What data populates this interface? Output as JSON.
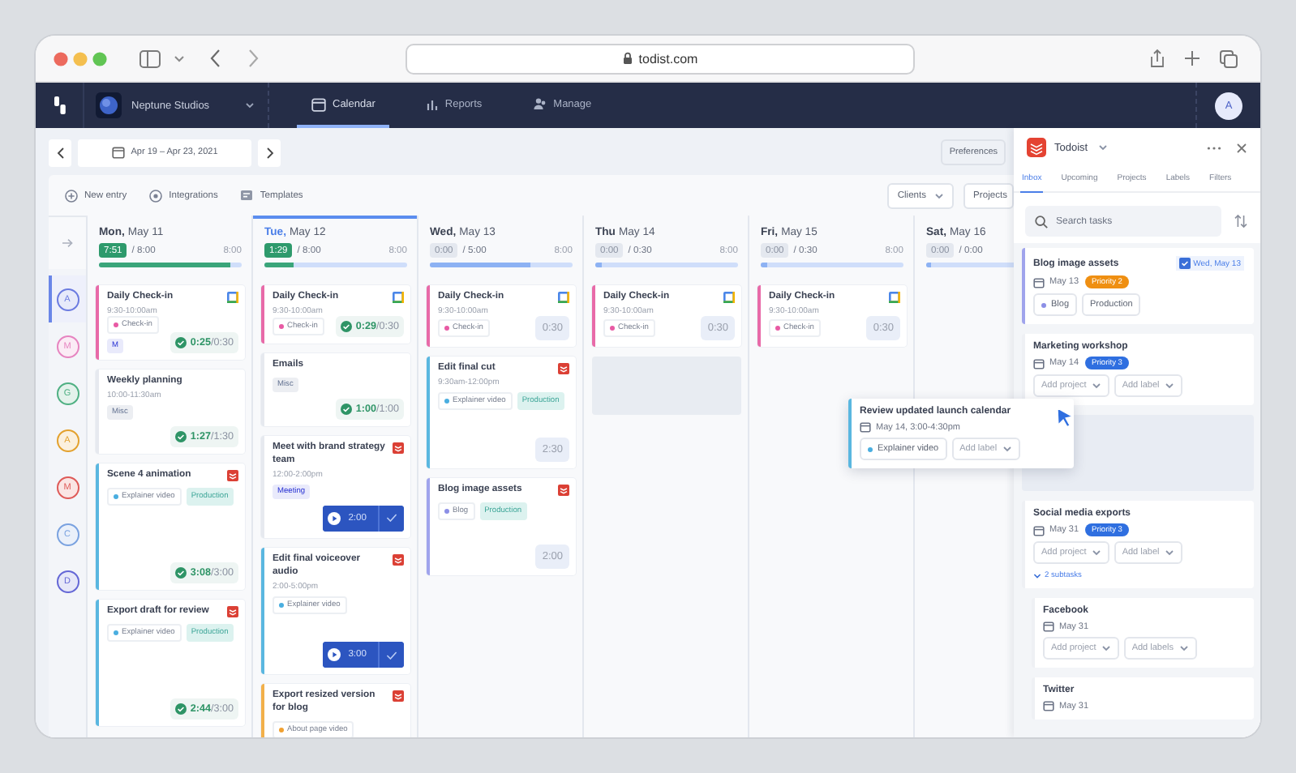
{
  "browser": {
    "address": "todist.com"
  },
  "nav": {
    "workspace": "Neptune Studios",
    "avatar": "A",
    "tabs": [
      {
        "label": "Calendar",
        "selected": true
      },
      {
        "label": "Reports",
        "selected": false
      },
      {
        "label": "Manage",
        "selected": false
      }
    ]
  },
  "date_range": "Apr 19 – Apr 23, 2021",
  "preferences": "Preferences",
  "toolbar": {
    "actions": [
      {
        "label": "New entry"
      },
      {
        "label": "Integrations"
      },
      {
        "label": "Templates"
      }
    ],
    "filters": [
      {
        "label": "Clients",
        "caret": true
      },
      {
        "label": "Projects",
        "caret": false
      }
    ]
  },
  "people": [
    {
      "initial": "A",
      "color": "#6b7be0",
      "selected": true
    },
    {
      "initial": "M",
      "color": "#e684c0",
      "selected": false
    },
    {
      "initial": "G",
      "color": "#4fb083",
      "selected": false
    },
    {
      "initial": "A",
      "color": "#e3a12e",
      "selected": false
    },
    {
      "initial": "M",
      "color": "#de5a58",
      "selected": false
    },
    {
      "initial": "C",
      "color": "#7aa2e0",
      "selected": false
    },
    {
      "initial": "D",
      "color": "#6467d6",
      "selected": false
    }
  ],
  "days": [
    {
      "weekday": "Mon,",
      "date": "May 11",
      "selected": false,
      "tracked": "7:51",
      "planned": "/ 8:00",
      "capacity": "8:00",
      "kind": "tracked",
      "level": 0.92,
      "cards": [
        {
          "kind": "event",
          "title": "Daily Check-in",
          "time": "9:30-10:00am",
          "color": "#e86aa8",
          "tags": [
            {
              "label": "Check-in",
              "kind": "project",
              "color": "#e85aa4"
            },
            {
              "label": "M",
              "kind": "label",
              "color": "#e9eafb"
            }
          ],
          "timer": {
            "kind": "tracked",
            "value": "0:25",
            "planned": "/0:30"
          }
        },
        {
          "kind": "entry",
          "title": "Weekly planning",
          "time": "10:00-11:30am",
          "tags": [
            {
              "label": "Misc",
              "kind": "label",
              "color": "#eceef2"
            }
          ],
          "timer": {
            "kind": "tracked",
            "value": "1:27",
            "planned": "/1:30"
          }
        },
        {
          "kind": "task",
          "title": "Scene 4 animation",
          "color": "#5ab7e0",
          "tags": [
            {
              "label": "Explainer video",
              "kind": "project",
              "color": "#4aaee0"
            },
            {
              "label": "Production",
              "kind": "label",
              "color": "#dcf2ef"
            }
          ],
          "timer": {
            "kind": "tracked",
            "value": "3:08",
            "planned": "/3:00"
          }
        },
        {
          "kind": "task",
          "title": "Export draft for review",
          "color": "#5ab7e0",
          "tags": [
            {
              "label": "Explainer video",
              "kind": "project",
              "color": "#4aaee0"
            },
            {
              "label": "Production",
              "kind": "label",
              "color": "#dcf2ef"
            }
          ],
          "timer": {
            "kind": "tracked",
            "value": "2:44",
            "planned": "/3:00"
          }
        }
      ]
    },
    {
      "weekday": "Tue,",
      "date": "May 12",
      "selected": true,
      "tracked": "1:29",
      "planned": "/ 8:00",
      "capacity": "8:00",
      "kind": "tracked",
      "level": 0.2,
      "cards": [
        {
          "kind": "event",
          "title": "Daily Check-in",
          "time": "9:30-10:00am",
          "color": "#e86aa8",
          "tags": [
            {
              "label": "Check-in",
              "kind": "project",
              "color": "#e85aa4"
            }
          ],
          "timer": {
            "kind": "tracked",
            "value": "0:29",
            "planned": "/0:30"
          }
        },
        {
          "kind": "entry",
          "title": "Emails",
          "tags": [
            {
              "label": "Misc",
              "kind": "label",
              "color": "#eceef2"
            }
          ],
          "timer": {
            "kind": "tracked",
            "value": "1:00",
            "planned": "/1:00"
          }
        },
        {
          "kind": "task",
          "title": "Meet with brand strategy team",
          "time": "12:00-2:00pm",
          "tags": [
            {
              "label": "Meeting",
              "kind": "label",
              "color": "#e9eafb"
            }
          ],
          "timer": {
            "kind": "running",
            "value": "2:00"
          }
        },
        {
          "kind": "task",
          "title": "Edit final voiceover audio",
          "time": "2:00-5:00pm",
          "color": "#5ab7e0",
          "tags": [
            {
              "label": "Explainer video",
              "kind": "project",
              "color": "#4aaee0"
            }
          ],
          "timer": {
            "kind": "running",
            "value": "3:00"
          }
        },
        {
          "kind": "task",
          "title": "Export resized version for blog",
          "color": "#f2b04a",
          "tags": [
            {
              "label": "About page video",
              "kind": "project",
              "color": "#f0a030"
            }
          ]
        }
      ]
    },
    {
      "weekday": "Wed,",
      "date": "May 13",
      "selected": false,
      "tracked": "0:00",
      "planned": "/ 5:00",
      "capacity": "8:00",
      "kind": "open",
      "level": 0.7,
      "cards": [
        {
          "kind": "event",
          "title": "Daily Check-in",
          "time": "9:30-10:00am",
          "color": "#e86aa8",
          "tags": [
            {
              "label": "Check-in",
              "kind": "project",
              "color": "#e85aa4"
            }
          ],
          "timer": {
            "kind": "planned",
            "value": "0:30"
          }
        },
        {
          "kind": "task",
          "title": "Edit final cut",
          "time": "9:30am-12:00pm",
          "color": "#5ab7e0",
          "tags": [
            {
              "label": "Explainer video",
              "kind": "project",
              "color": "#4aaee0"
            },
            {
              "label": "Production",
              "kind": "label",
              "color": "#dcf2ef"
            }
          ],
          "timer": {
            "kind": "planned",
            "value": "2:30"
          }
        },
        {
          "kind": "task",
          "title": "Blog image assets",
          "color": "#a0a4ec",
          "tags": [
            {
              "label": "Blog",
              "kind": "project",
              "color": "#8c8fe6"
            },
            {
              "label": "Production",
              "kind": "label",
              "color": "#dcf2ef"
            }
          ],
          "timer": {
            "kind": "planned",
            "value": "2:00"
          }
        }
      ]
    },
    {
      "weekday": "Thu",
      "date": "May 14",
      "selected": false,
      "tracked": "0:00",
      "planned": "/ 0:30",
      "capacity": "8:00",
      "kind": "open",
      "level": 0.05,
      "cards": [
        {
          "kind": "event",
          "title": "Daily Check-in",
          "time": "9:30-10:00am",
          "color": "#e86aa8",
          "tags": [
            {
              "label": "Check-in",
              "kind": "project",
              "color": "#e85aa4"
            }
          ],
          "timer": {
            "kind": "planned",
            "value": "0:30"
          }
        },
        {
          "kind": "placeholder"
        }
      ]
    },
    {
      "weekday": "Fri,",
      "date": "May 15",
      "selected": false,
      "tracked": "0:00",
      "planned": "/ 0:30",
      "capacity": "8:00",
      "kind": "open",
      "level": 0.05,
      "cards": [
        {
          "kind": "event",
          "title": "Daily Check-in",
          "time": "9:30-10:00am",
          "color": "#e86aa8",
          "tags": [
            {
              "label": "Check-in",
              "kind": "project",
              "color": "#e85aa4"
            }
          ],
          "timer": {
            "kind": "planned",
            "value": "0:30"
          }
        }
      ]
    },
    {
      "weekday": "Sat,",
      "date": "May 16",
      "selected": false,
      "tracked": "0:00",
      "planned": "/ 0:00",
      "kind": "open",
      "level": 0.03
    }
  ],
  "dragged_card": {
    "title": "Review updated launch calendar",
    "when": "May 14, 3:00-4:30pm",
    "color": "#5ab7e0",
    "chips": [
      {
        "label": "Explainer video",
        "kind": "project",
        "color": "#4aaee0"
      },
      {
        "label": "Add label",
        "kind": "menu"
      }
    ]
  },
  "todoist": {
    "title": "Todoist",
    "tabs": [
      {
        "label": "Inbox",
        "selected": true
      },
      {
        "label": "Upcoming",
        "selected": false
      },
      {
        "label": "Projects",
        "selected": false
      },
      {
        "label": "Labels",
        "selected": false
      },
      {
        "label": "Filters",
        "selected": false
      }
    ],
    "search": {
      "placeholder": "Search tasks"
    },
    "tasks": [
      {
        "title": "Blog image assets",
        "due": "May 13",
        "priority": {
          "label": "Priority 2",
          "color": "#ef8f12"
        },
        "scheduled": "Wed, May 13",
        "color": "#a0a4ec",
        "chips": [
          {
            "label": "Blog",
            "kind": "project",
            "color": "#8c8fe6"
          },
          {
            "label": "Production",
            "kind": "plain"
          }
        ]
      },
      {
        "title": "Marketing workshop",
        "due": "May 14",
        "priority": {
          "label": "Priority 3",
          "color": "#2f6fe0"
        },
        "chips": [
          {
            "label": "Add project",
            "kind": "menu"
          },
          {
            "label": "Add label",
            "kind": "menu"
          }
        ]
      },
      {
        "kind": "placeholder"
      },
      {
        "title": "Social media exports",
        "due": "May 31",
        "priority": {
          "label": "Priority 3",
          "color": "#2f6fe0"
        },
        "chips": [
          {
            "label": "Add project",
            "kind": "menu"
          },
          {
            "label": "Add label",
            "kind": "menu"
          }
        ],
        "subtasks": {
          "label": "2 subtasks",
          "expanded": true
        },
        "children": [
          {
            "title": "Facebook",
            "due": "May 31",
            "chips": [
              {
                "label": "Add project",
                "kind": "menu"
              },
              {
                "label": "Add labels",
                "kind": "menu"
              }
            ]
          },
          {
            "title": "Twitter",
            "due": "May 31"
          }
        ]
      }
    ]
  }
}
